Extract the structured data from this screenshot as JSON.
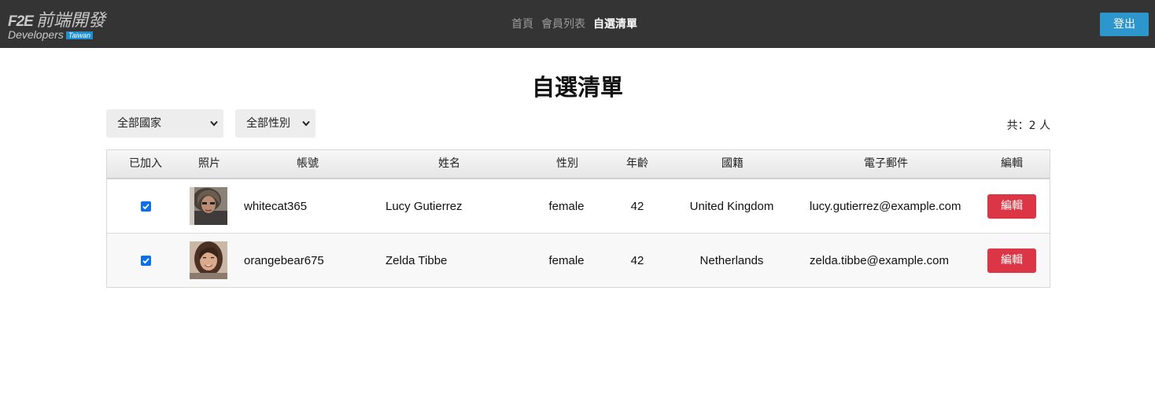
{
  "header": {
    "logo": {
      "mark": "F2E",
      "name": "前端開發",
      "subtitle": "Developers",
      "badge": "Taiwan"
    },
    "nav": [
      "首頁",
      "會員列表",
      "自選清單"
    ],
    "active_nav": "自選清單",
    "logout_label": "登出"
  },
  "page": {
    "title": "自選清單",
    "filters": {
      "country": "全部國家",
      "gender": "全部性別"
    },
    "count_label": "共：2 人"
  },
  "table": {
    "headers": [
      "已加入",
      "照片",
      "帳號",
      "姓名",
      "性別",
      "年齡",
      "國籍",
      "電子郵件",
      "編輯"
    ],
    "rows": [
      {
        "added": true,
        "photo": "avatar-photo",
        "username": "whitecat365",
        "name": "Lucy Gutierrez",
        "gender": "female",
        "age": "42",
        "nationality": "United Kingdom",
        "email": "lucy.gutierrez@example.com",
        "edit_label": "編輯"
      },
      {
        "added": true,
        "photo": "avatar-photo",
        "username": "orangebear675",
        "name": "Zelda Tibbe",
        "gender": "female",
        "age": "42",
        "nationality": "Netherlands",
        "email": "zelda.tibbe@example.com",
        "edit_label": "編輯"
      }
    ]
  },
  "colors": {
    "navbar": "#343434",
    "logout": "#2d96cc",
    "edit": "#dc3545",
    "checkbox": "#0a6fe8"
  },
  "icons": {
    "select_arrow": "chevron-down-icon",
    "check": "check-icon"
  }
}
